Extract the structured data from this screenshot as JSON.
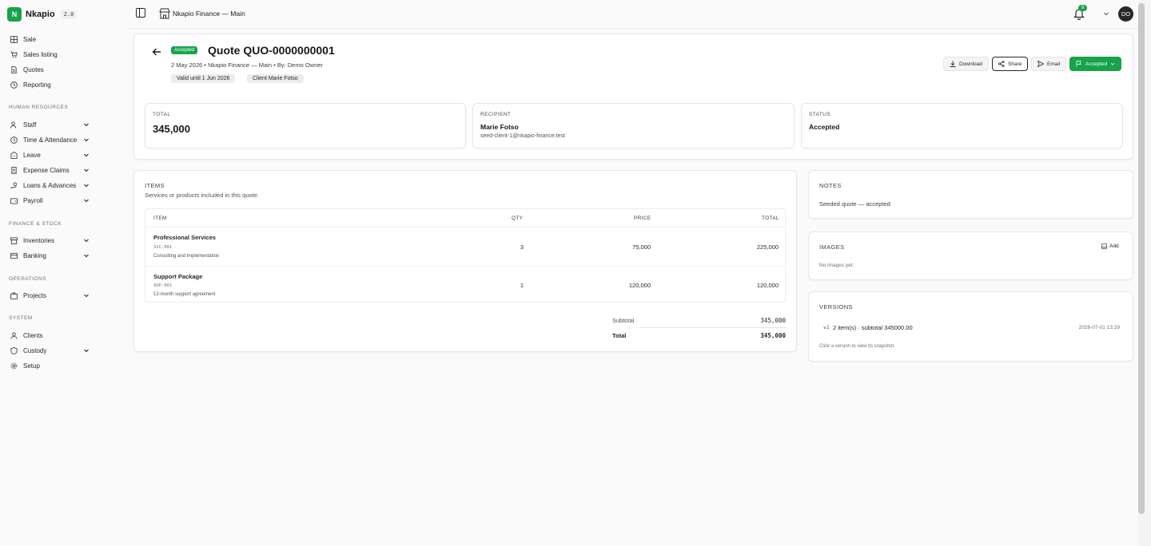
{
  "brand": {
    "logo_letter": "N",
    "name": "Nkapio",
    "version": "2.0"
  },
  "sidebar": {
    "items": [
      {
        "label": "Sale",
        "icon": "grid-icon"
      },
      {
        "label": "Sales listing",
        "icon": "cart-icon"
      },
      {
        "label": "Quotes",
        "icon": "document-icon"
      },
      {
        "label": "Reporting",
        "icon": "clock-icon"
      }
    ],
    "sections": [
      {
        "title": "HUMAN RESOURCES",
        "items": [
          {
            "label": "Staff",
            "icon": "users-icon"
          },
          {
            "label": "Time & Attendance",
            "icon": "clock-icon"
          },
          {
            "label": "Leave",
            "icon": "building-icon"
          },
          {
            "label": "Expense Claims",
            "icon": "receipt-icon"
          },
          {
            "label": "Loans & Advances",
            "icon": "hand-coins-icon"
          },
          {
            "label": "Payroll",
            "icon": "wallet-icon"
          }
        ]
      },
      {
        "title": "FINANCE & STOCK",
        "items": [
          {
            "label": "Inventories",
            "icon": "box-icon"
          },
          {
            "label": "Banking",
            "icon": "bank-icon"
          }
        ]
      },
      {
        "title": "OPERATIONS",
        "items": [
          {
            "label": "Projects",
            "icon": "briefcase-icon"
          }
        ]
      },
      {
        "title": "SYSTEM",
        "items": [
          {
            "label": "Clients",
            "icon": "user-icon"
          },
          {
            "label": "Custody",
            "icon": "shield-icon"
          },
          {
            "label": "Setup",
            "icon": "gear-icon"
          }
        ]
      }
    ]
  },
  "topbar": {
    "title": "Nkapio Finance — Main",
    "notifications": "9",
    "avatar_initials": "DO"
  },
  "quote": {
    "status_badge": "Accepted",
    "title": "Quote QUO-0000000001",
    "meta": "2 May 2026 • Nkapio Finance — Main • By: Demo Owner",
    "valid_pill": "Valid until 1 Jun 2026",
    "client_pill": "Client Marie Fotso"
  },
  "actions": {
    "download": "Download",
    "share": "Share",
    "email": "Email",
    "status": "Accepted"
  },
  "stats": {
    "total_label": "TOTAL",
    "total_value": "345,000",
    "recipient_label": "RECIPIENT",
    "recipient_name": "Marie Fotso",
    "recipient_email": "seed-client-1@nkapio-finance.test",
    "status_label": "STATUS",
    "status_value": "Accepted"
  },
  "items": {
    "title": "ITEMS",
    "subtitle": "Services or products included in this quote.",
    "columns": {
      "item": "ITEM",
      "qty": "QTY",
      "price": "PRICE",
      "total": "TOTAL"
    },
    "rows": [
      {
        "name": "Professional Services",
        "sku": "SVC-001",
        "desc": "Consulting and implementation",
        "qty": "3",
        "price": "75,000",
        "total": "225,000"
      },
      {
        "name": "Support Package",
        "sku": "SUP-001",
        "desc": "12-month support agreement",
        "qty": "1",
        "price": "120,000",
        "total": "120,000"
      }
    ],
    "subtotal_label": "Subtotal",
    "subtotal_value": "345,000",
    "total_label": "Total",
    "total_value": "345,000"
  },
  "notes": {
    "title": "NOTES",
    "text": "Seeded quote — accepted"
  },
  "images": {
    "title": "IMAGES",
    "add_label": "Add",
    "empty": "No images yet."
  },
  "versions": {
    "title": "VERSIONS",
    "entries": [
      {
        "tag": "v1",
        "summary": "2 item(s) · subtotal 345000.00",
        "date": "2026-07-01 13:29"
      }
    ],
    "hint": "Click a version to view its snapshot."
  },
  "colors": {
    "accent": "#16a34a"
  }
}
